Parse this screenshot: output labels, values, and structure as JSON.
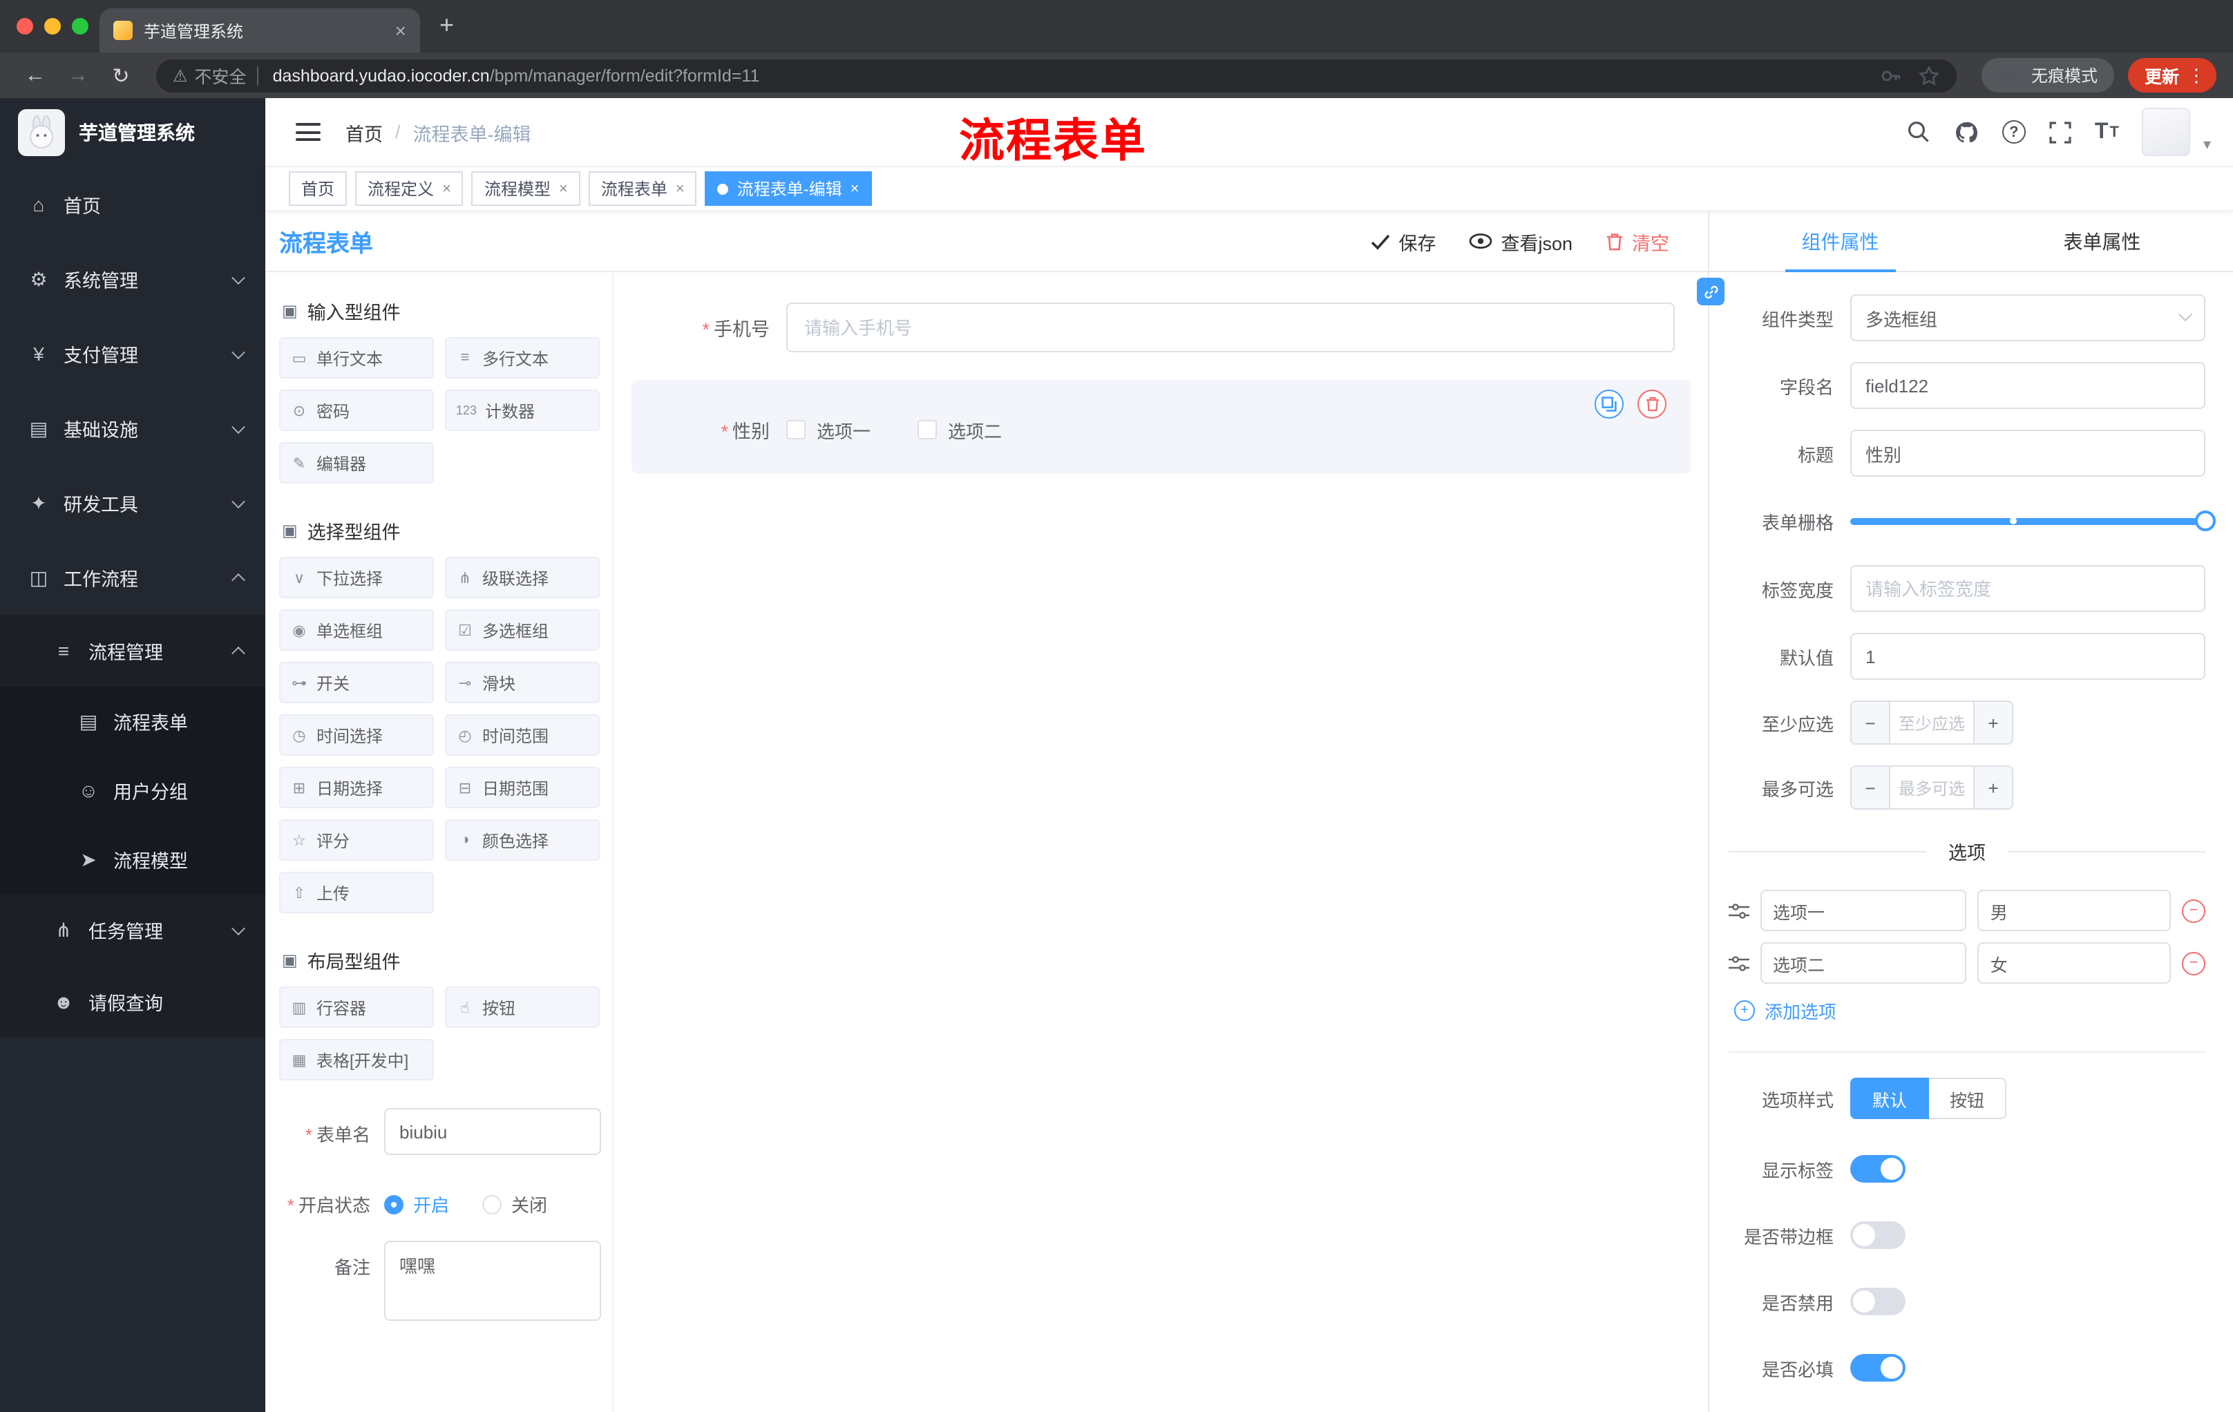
{
  "colors": {
    "primary": "#409eff",
    "danger": "#f56c6c",
    "annotation": "#fe0000",
    "active_tag": "#409eff"
  },
  "glyphs": {
    "close": "×",
    "new_tab": "+",
    "back": "←",
    "forward": "→",
    "reload": "↻",
    "warning": "⚠",
    "kebab": "⋮",
    "caret_down": "▾",
    "question": "?",
    "font_size": "T",
    "asterisk": "*",
    "minus": "−",
    "plus": "+",
    "slash": "/"
  },
  "browser": {
    "tab_title": "芋道管理系统",
    "security_label": "不安全",
    "url_domain": "dashboard.yudao.iocoder.cn",
    "url_path": "/bpm/manager/form/edit?formId=11",
    "incognito_label": "无痕模式",
    "update_label": "更新"
  },
  "sidebar": {
    "logo_title": "芋道管理系统",
    "menu": [
      {
        "label": "首页",
        "icon": "⌂"
      },
      {
        "label": "系统管理",
        "icon": "⚙"
      },
      {
        "label": "支付管理",
        "icon": "¥"
      },
      {
        "label": "基础设施",
        "icon": "▤"
      },
      {
        "label": "研发工具",
        "icon": "✦"
      },
      {
        "label": "工作流程",
        "icon": "◫"
      },
      {
        "label": "流程管理",
        "icon": "≡"
      },
      {
        "label": "流程表单",
        "icon": "▤"
      },
      {
        "label": "用户分组",
        "icon": "☺"
      },
      {
        "label": "流程模型",
        "icon": "➤"
      },
      {
        "label": "任务管理",
        "icon": "⋔"
      },
      {
        "label": "请假查询",
        "icon": "☻"
      }
    ]
  },
  "header": {
    "breadcrumb_home": "首页",
    "breadcrumb_current": "流程表单-编辑",
    "annotation": "流程表单"
  },
  "tags": {
    "items": [
      {
        "label": "首页"
      },
      {
        "label": "流程定义"
      },
      {
        "label": "流程模型"
      },
      {
        "label": "流程表单"
      },
      {
        "label": "流程表单-编辑"
      }
    ]
  },
  "designer": {
    "panel_title": "流程表单",
    "toolbar": {
      "save": "保存",
      "view_json": "查看json",
      "clear": "清空"
    },
    "groups": [
      {
        "title": "输入型组件",
        "items": [
          {
            "label": "单行文本",
            "glyph": "▭"
          },
          {
            "label": "多行文本",
            "glyph": "≡"
          },
          {
            "label": "密码",
            "glyph": "⊙"
          },
          {
            "label": "计数器",
            "glyph": "123"
          },
          {
            "label": "编辑器",
            "glyph": "✎"
          }
        ]
      },
      {
        "title": "选择型组件",
        "items": [
          {
            "label": "下拉选择",
            "glyph": "∨"
          },
          {
            "label": "级联选择",
            "glyph": "⋔"
          },
          {
            "label": "单选框组",
            "glyph": "◉"
          },
          {
            "label": "多选框组",
            "glyph": "☑"
          },
          {
            "label": "开关",
            "glyph": "⊶"
          },
          {
            "label": "滑块",
            "glyph": "⊸"
          },
          {
            "label": "时间选择",
            "glyph": "◷"
          },
          {
            "label": "时间范围",
            "glyph": "◴"
          },
          {
            "label": "日期选择",
            "glyph": "⊞"
          },
          {
            "label": "日期范围",
            "glyph": "⊟"
          },
          {
            "label": "评分",
            "glyph": "☆"
          },
          {
            "label": "颜色选择",
            "glyph": "◑"
          },
          {
            "label": "上传",
            "glyph": "⇧"
          }
        ]
      },
      {
        "title": "布局型组件",
        "items": [
          {
            "label": "行容器",
            "glyph": "▥"
          },
          {
            "label": "按钮",
            "glyph": "☝"
          },
          {
            "label": "表格[开发中]",
            "glyph": "▦"
          }
        ]
      }
    ],
    "meta": {
      "name_label": "表单名",
      "name_value": "biubiu",
      "status_label": "开启状态",
      "status_on": "开启",
      "status_off": "关闭",
      "remark_label": "备注",
      "remark_value": "嘿嘿"
    },
    "canvas": {
      "phone_label": "手机号",
      "phone_placeholder": "请输入手机号",
      "gender_label": "性别",
      "gender_options": [
        "选项一",
        "选项二"
      ]
    }
  },
  "properties": {
    "tab_component": "组件属性",
    "tab_form": "表单属性",
    "rows": {
      "type_label": "组件类型",
      "type_value": "多选框组",
      "field_label": "字段名",
      "field_value": "field122",
      "title_label": "标题",
      "title_value": "性别",
      "grid_label": "表单栅格",
      "width_label": "标签宽度",
      "width_placeholder": "请输入标签宽度",
      "default_label": "默认值",
      "default_value": "1",
      "min_label": "至少应选",
      "min_placeholder": "至少应选",
      "max_label": "最多可选",
      "max_placeholder": "最多可选"
    },
    "options": {
      "divider": "选项",
      "rows": [
        {
          "name": "选项一",
          "value": "男"
        },
        {
          "name": "选项二",
          "value": "女"
        }
      ],
      "add_label": "添加选项"
    },
    "style": {
      "label": "选项样式",
      "default": "默认",
      "button": "按钮"
    },
    "switches": [
      {
        "label": "显示标签",
        "on": true
      },
      {
        "label": "是否带边框",
        "on": false
      },
      {
        "label": "是否禁用",
        "on": false
      },
      {
        "label": "是否必填",
        "on": true
      }
    ]
  }
}
